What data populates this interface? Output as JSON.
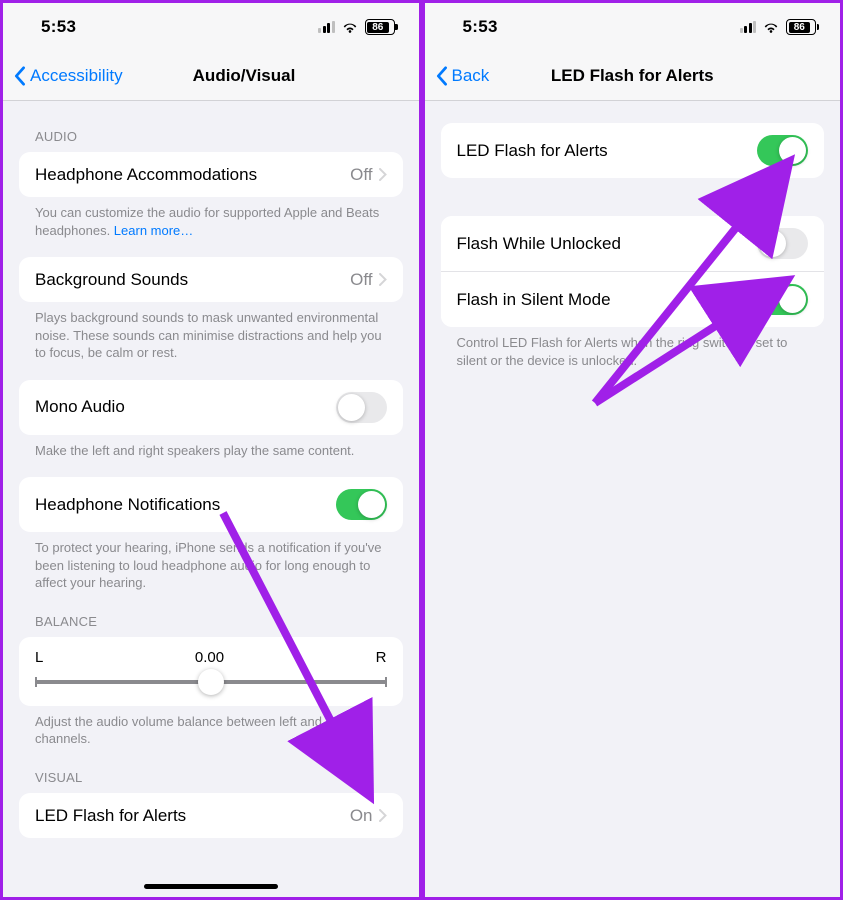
{
  "status": {
    "time": "5:53",
    "battery": "86"
  },
  "left": {
    "back_label": "Accessibility",
    "title": "Audio/Visual",
    "sections": {
      "audio_header": "AUDIO",
      "headphone_accommodations": {
        "label": "Headphone Accommodations",
        "value": "Off"
      },
      "headphone_footer": "You can customize the audio for supported Apple and Beats headphones. ",
      "learn_more": "Learn more…",
      "background_sounds": {
        "label": "Background Sounds",
        "value": "Off"
      },
      "background_footer": "Plays background sounds to mask unwanted environmental noise. These sounds can minimise distractions and help you to focus, be calm or rest.",
      "mono_audio": {
        "label": "Mono Audio"
      },
      "mono_footer": "Make the left and right speakers play the same content.",
      "headphone_notifications": {
        "label": "Headphone Notifications"
      },
      "headphone_notif_footer": "To protect your hearing, iPhone sends a notification if you've been listening to loud headphone audio for long enough to affect your hearing.",
      "balance_header": "BALANCE",
      "balance": {
        "left": "L",
        "value": "0.00",
        "right": "R"
      },
      "balance_footer": "Adjust the audio volume balance between left and right channels.",
      "visual_header": "VISUAL",
      "led_flash": {
        "label": "LED Flash for Alerts",
        "value": "On"
      }
    }
  },
  "right": {
    "back_label": "Back",
    "title": "LED Flash for Alerts",
    "led_flash_alerts": {
      "label": "LED Flash for Alerts"
    },
    "flash_unlocked": {
      "label": "Flash While Unlocked"
    },
    "flash_silent": {
      "label": "Flash in Silent Mode"
    },
    "footer": "Control LED Flash for Alerts when the ring switch is set to silent or the device is unlocked."
  }
}
